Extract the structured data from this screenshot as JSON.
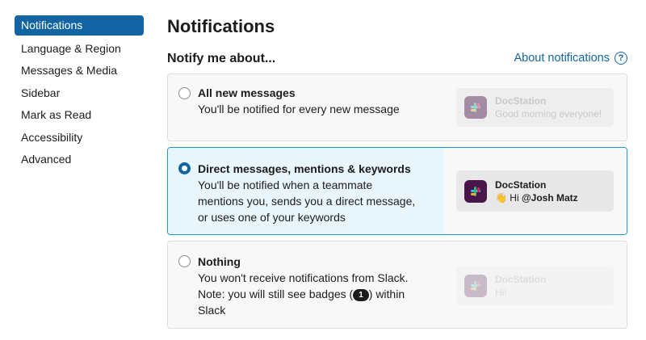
{
  "sidebar": {
    "items": [
      {
        "label": "Notifications",
        "active": true
      },
      {
        "label": "Language & Region"
      },
      {
        "label": "Messages & Media"
      },
      {
        "label": "Sidebar"
      },
      {
        "label": "Mark as Read"
      },
      {
        "label": "Accessibility"
      },
      {
        "label": "Advanced"
      }
    ]
  },
  "header": {
    "title": "Notifications",
    "section": "Notify me about...",
    "about_link": "About notifications",
    "help_icon": "question-circle-icon"
  },
  "options": [
    {
      "title": "All new messages",
      "desc": "You'll be notified for every new message",
      "selected": false,
      "preview": {
        "app": "DocStation",
        "text": "Good morning everyone!",
        "icon": "slack-logo-icon"
      }
    },
    {
      "title": "Direct messages, mentions & keywords",
      "desc": "You'll be notified when a teammate mentions you, sends you a direct message, or uses one of your keywords",
      "selected": true,
      "preview": {
        "app": "DocStation",
        "emoji": "👋",
        "text_prefix": "Hi ",
        "mention": "@Josh Matz",
        "icon": "slack-logo-icon"
      }
    },
    {
      "title": "Nothing",
      "desc_before": "You won't receive notifications from Slack. Note: you will still see badges (",
      "badge": "1",
      "desc_after": ") within Slack",
      "selected": false,
      "preview": {
        "app": "DocStation",
        "text": "Hi!",
        "icon": "slack-logo-icon"
      }
    }
  ],
  "colors": {
    "accent": "#1264a3",
    "selected_border": "#1d9bd1",
    "selected_bg": "#e8f5fa",
    "app_icon_bg": "#4a154b"
  }
}
